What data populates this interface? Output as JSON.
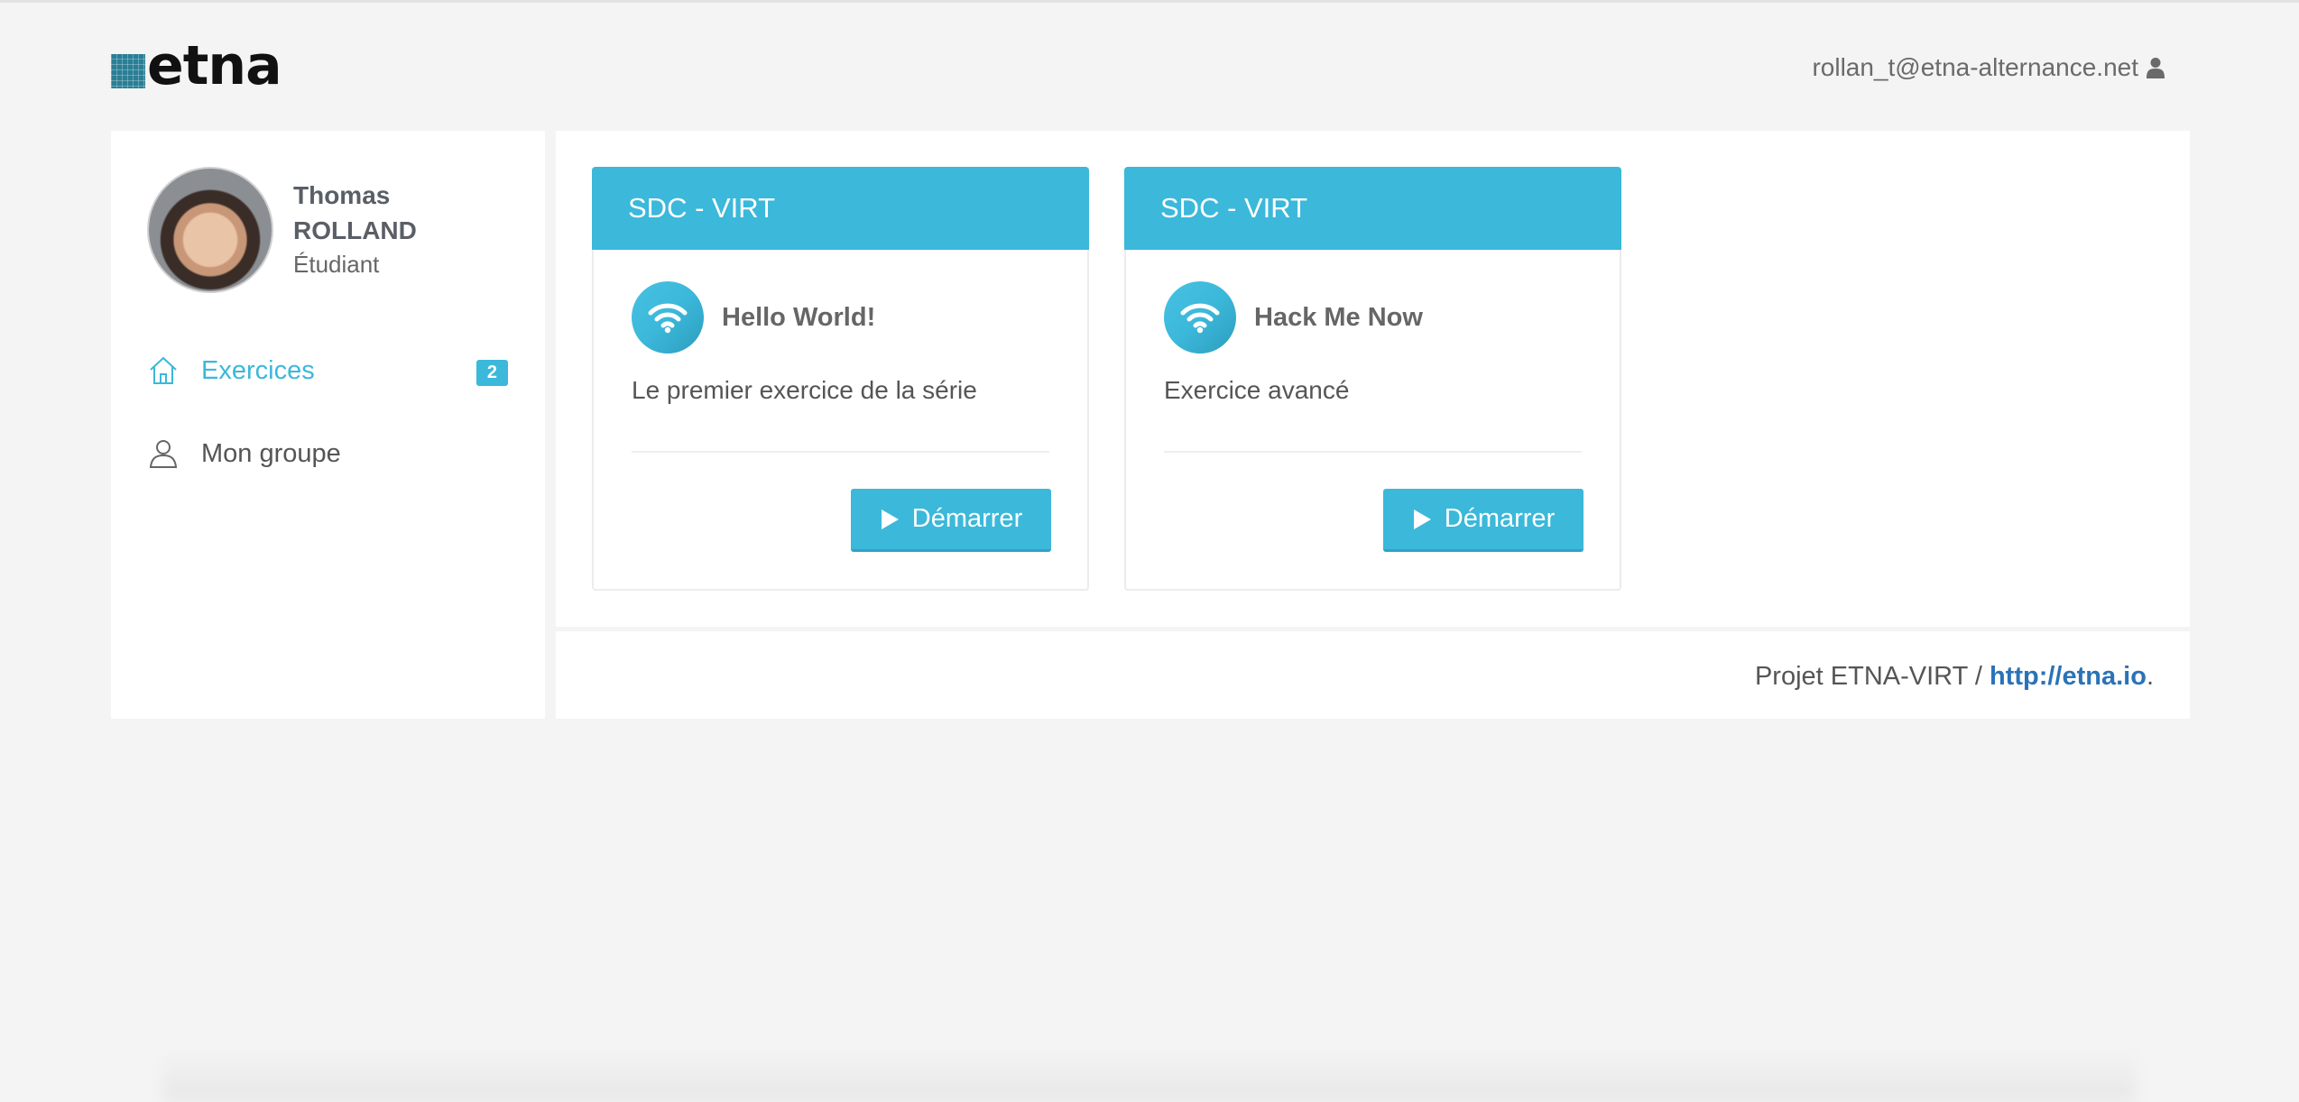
{
  "header": {
    "logo_text": "etna",
    "user_email": "rollan_t@etna-alternance.net"
  },
  "sidebar": {
    "profile": {
      "first_name": "Thomas",
      "last_name": "ROLLAND",
      "role": "Étudiant"
    },
    "items": [
      {
        "label": "Exercices",
        "badge": "2",
        "icon": "home-icon",
        "active": true
      },
      {
        "label": "Mon groupe",
        "icon": "user-icon",
        "active": false
      }
    ]
  },
  "cards": [
    {
      "header": "SDC - VIRT",
      "title": "Hello World!",
      "description": "Le premier exercice de la série",
      "button_label": "Démarrer",
      "icon": "wifi-icon"
    },
    {
      "header": "SDC - VIRT",
      "title": "Hack Me Now",
      "description": "Exercice avancé",
      "button_label": "Démarrer",
      "icon": "wifi-icon"
    }
  ],
  "footer": {
    "text": "Projet ETNA-VIRT / ",
    "link_text": "http://etna.io",
    "suffix": "."
  },
  "colors": {
    "accent": "#3bb8da",
    "link": "#2a73b8",
    "background": "#f4f4f4"
  }
}
